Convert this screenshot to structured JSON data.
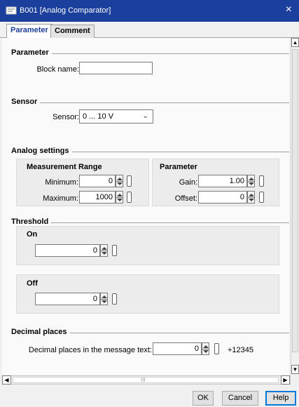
{
  "window": {
    "title": "B001 [Analog Comparator]",
    "close": "×"
  },
  "tabs": [
    {
      "label": "Parameter",
      "active": true
    },
    {
      "label": "Comment",
      "active": false
    }
  ],
  "parameter_section": {
    "title": "Parameter",
    "block_name_label": "Block name:",
    "block_name_value": ""
  },
  "sensor_section": {
    "title": "Sensor",
    "sensor_label": "Sensor:",
    "sensor_value": "0 ... 10 V"
  },
  "analog_settings": {
    "title": "Analog settings",
    "measurement_range": {
      "title": "Measurement Range",
      "minimum_label": "Minimum:",
      "minimum_value": "0",
      "maximum_label": "Maximum:",
      "maximum_value": "1000"
    },
    "parameter": {
      "title": "Parameter",
      "gain_label": "Gain:",
      "gain_value": "1.00",
      "offset_label": "Offset:",
      "offset_value": "0"
    }
  },
  "threshold": {
    "title": "Threshold",
    "on_label": "On",
    "on_value": "0",
    "off_label": "Off",
    "off_value": "0"
  },
  "decimal_places": {
    "title": "Decimal places",
    "label": "Decimal places in the message text:",
    "value": "0",
    "preview": "+12345"
  },
  "scrollbar": {
    "grip": "III"
  },
  "footer": {
    "ok_label": "OK",
    "cancel_label": "Cancel",
    "help_label": "Help"
  },
  "colors": {
    "titlebar": "#1a3f9c",
    "accent": "#0078d7"
  }
}
